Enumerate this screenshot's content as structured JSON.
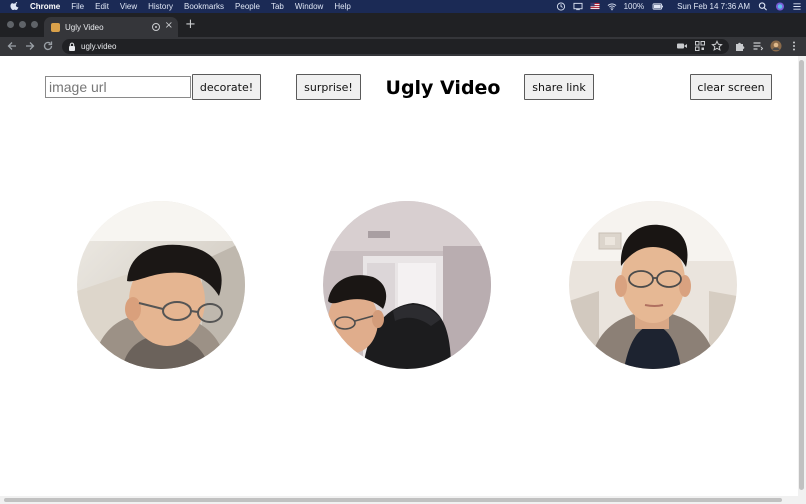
{
  "os_menubar": {
    "app_name": "Chrome",
    "menus": [
      "File",
      "Edit",
      "View",
      "History",
      "Bookmarks",
      "People",
      "Tab",
      "Window",
      "Help"
    ],
    "battery": "100%",
    "datetime": "Sun Feb 14  7:36 AM"
  },
  "browser": {
    "tab_title": "Ugly Video",
    "new_tab_label": "+",
    "close_tab_label": "×",
    "url": "ugly.video"
  },
  "page": {
    "image_url_placeholder": "image url",
    "decorate_label": "decorate!",
    "surprise_label": "surprise!",
    "title": "Ugly Video",
    "share_label": "share link",
    "clear_label": "clear screen"
  },
  "video_tiles": [
    {
      "name": "video-tile-1"
    },
    {
      "name": "video-tile-2"
    },
    {
      "name": "video-tile-3"
    }
  ],
  "colors": {
    "menubar_bg": "#1b2a55",
    "tabstrip_bg": "#202124",
    "toolbar_bg": "#35363a",
    "button_bg": "#f0f0f0"
  }
}
